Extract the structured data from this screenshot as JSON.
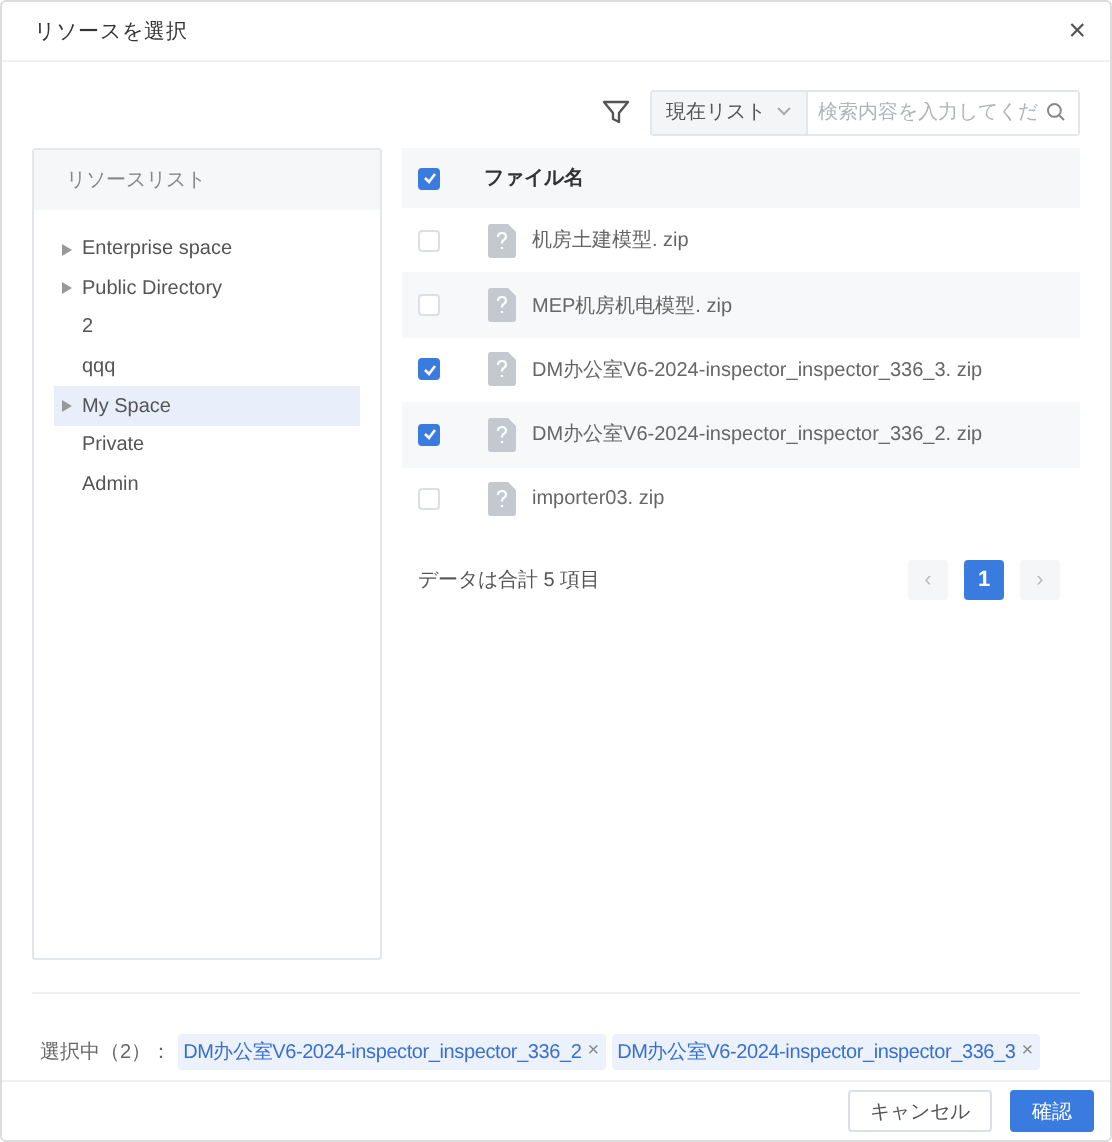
{
  "dialog": {
    "title": "リソースを選択",
    "close": "×"
  },
  "toolbar": {
    "scope": "現在リスト",
    "placeholder": "検索内容を入力してくだ"
  },
  "sidebar": {
    "title": "リソースリスト",
    "items": [
      {
        "label": "Enterprise space",
        "has_children": true,
        "selected": false
      },
      {
        "label": "Public Directory",
        "has_children": true,
        "selected": false
      },
      {
        "label": "2",
        "has_children": false,
        "selected": false
      },
      {
        "label": "qqq",
        "has_children": false,
        "selected": false
      },
      {
        "label": "My Space",
        "has_children": true,
        "selected": true
      },
      {
        "label": "Private",
        "has_children": false,
        "selected": false
      },
      {
        "label": "Admin",
        "has_children": false,
        "selected": false
      }
    ]
  },
  "table": {
    "all_checked": true,
    "column": "ファイル名",
    "rows": [
      {
        "name": "机房土建模型. zip",
        "checked": false
      },
      {
        "name": "MEP机房机电模型. zip",
        "checked": false
      },
      {
        "name": "DM办公室V6-2024-inspector_inspector_336_3. zip",
        "checked": true
      },
      {
        "name": "DM办公室V6-2024-inspector_inspector_336_2. zip",
        "checked": true
      },
      {
        "name": "importer03. zip",
        "checked": false
      }
    ]
  },
  "pagination": {
    "total": "データは合計 5 項目",
    "prev": "‹",
    "pages": [
      {
        "label": "1",
        "selected": true
      }
    ],
    "next": "›"
  },
  "selection": {
    "label": "選択中（2）：",
    "tags": [
      {
        "text": "DM办公室V6-2024-inspector_inspector_336_2",
        "remove": "×"
      },
      {
        "text": "DM办公室V6-2024-inspector_inspector_336_3",
        "remove": "×"
      }
    ]
  },
  "buttons": {
    "cancel": "キャンセル",
    "confirm": "確認"
  }
}
